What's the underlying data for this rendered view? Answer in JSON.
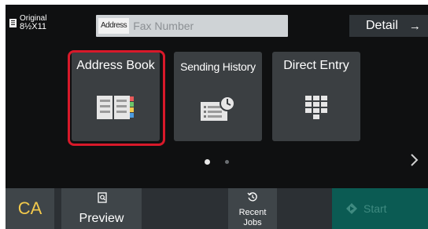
{
  "header": {
    "original_label": "Original",
    "original_size": "8½X11",
    "address_tag": "Address",
    "fax_placeholder": "Fax Number",
    "detail_label": "Detail",
    "detail_arrow": "→"
  },
  "tiles": [
    {
      "label": "Address Book",
      "icon": "address-book-icon",
      "selected": true
    },
    {
      "label": "Sending History",
      "icon": "sending-history-icon",
      "selected": false
    },
    {
      "label": "Direct Entry",
      "icon": "keypad-icon",
      "selected": false
    }
  ],
  "pagination": {
    "current_page": 1,
    "total_pages": 2
  },
  "bottom_bar": {
    "ca_label": "CA",
    "preview_label": "Preview",
    "recent_line1": "Recent",
    "recent_line2": "Jobs",
    "start_label": "Start"
  },
  "colors": {
    "highlight": "#d8192a",
    "ca_text": "#f2c94c",
    "start_bg": "#0b5b53",
    "tile_bg": "#3b3f42",
    "screen_bg": "#0f1011"
  }
}
